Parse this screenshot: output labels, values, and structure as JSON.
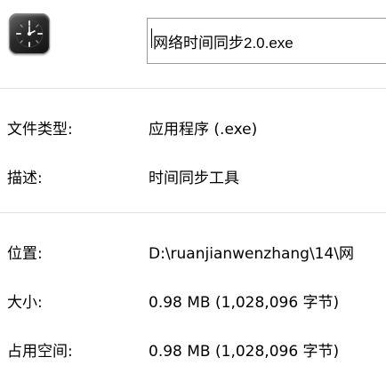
{
  "icon": {
    "name": "clock-app-icon",
    "bg_color": "#2a2a2a",
    "accent": "#ffffff"
  },
  "file_name": "网络时间同步2.0.exe",
  "general": {
    "type_label": "文件类型:",
    "type_value": "应用程序 (.exe)",
    "desc_label": "描述:",
    "desc_value": "时间同步工具"
  },
  "details": {
    "location_label": "位置:",
    "location_value": "D:\\ruanjianwenzhang\\14\\网",
    "size_label": "大小:",
    "size_value": "0.98 MB (1,028,096 字节)",
    "disk_label": "占用空间:",
    "disk_value": "0.98 MB (1,028,096 字节)"
  }
}
